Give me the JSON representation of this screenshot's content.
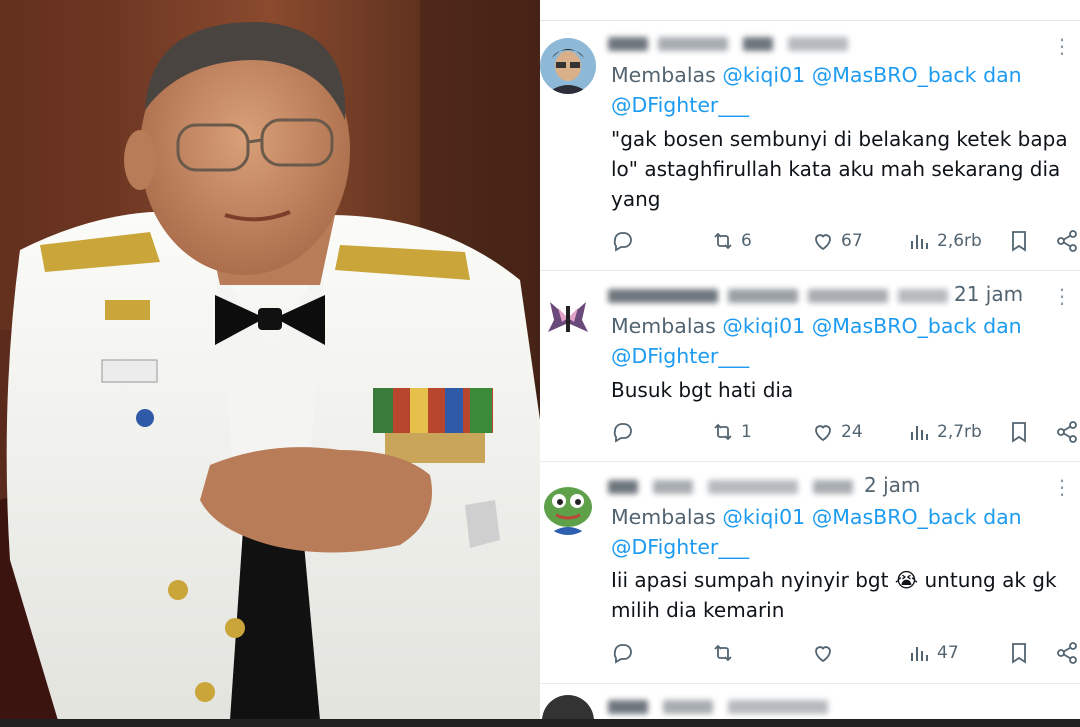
{
  "tweets": [
    {
      "time": "",
      "reply_prefix": "Membalas",
      "reply_mentions": "@kiqi01 @MasBRO_back dan @DFighter___",
      "text": "\"gak bosen sembunyi di belakang ketek bapa lo\" astaghfirullah kata aku mah sekarang dia yang",
      "replies": "",
      "retweets": "6",
      "likes": "67",
      "views": "2,6rb"
    },
    {
      "time": "21 jam",
      "reply_prefix": "Membalas",
      "reply_mentions": "@kiqi01 @MasBRO_back dan @DFighter___",
      "text": "Busuk bgt hati dia",
      "replies": "",
      "retweets": "1",
      "likes": "24",
      "views": "2,7rb"
    },
    {
      "time": "2 jam",
      "reply_prefix": "Membalas",
      "reply_mentions": "@kiqi01 @MasBRO_back dan @DFighter___",
      "text": "Iii apasi sumpah nyinyir bgt 😭 untung ak gk milih dia kemarin",
      "replies": "",
      "retweets": "",
      "likes": "",
      "views": "47"
    }
  ],
  "icons": {
    "reply": "reply-icon",
    "retweet": "retweet-icon",
    "like": "heart-icon",
    "views": "views-icon",
    "bookmark": "bookmark-icon",
    "share": "share-icon",
    "more": "more-icon"
  },
  "colors": {
    "mention": "#1d9bf0",
    "secondary_text": "#536471",
    "body_text": "#0f1419"
  }
}
